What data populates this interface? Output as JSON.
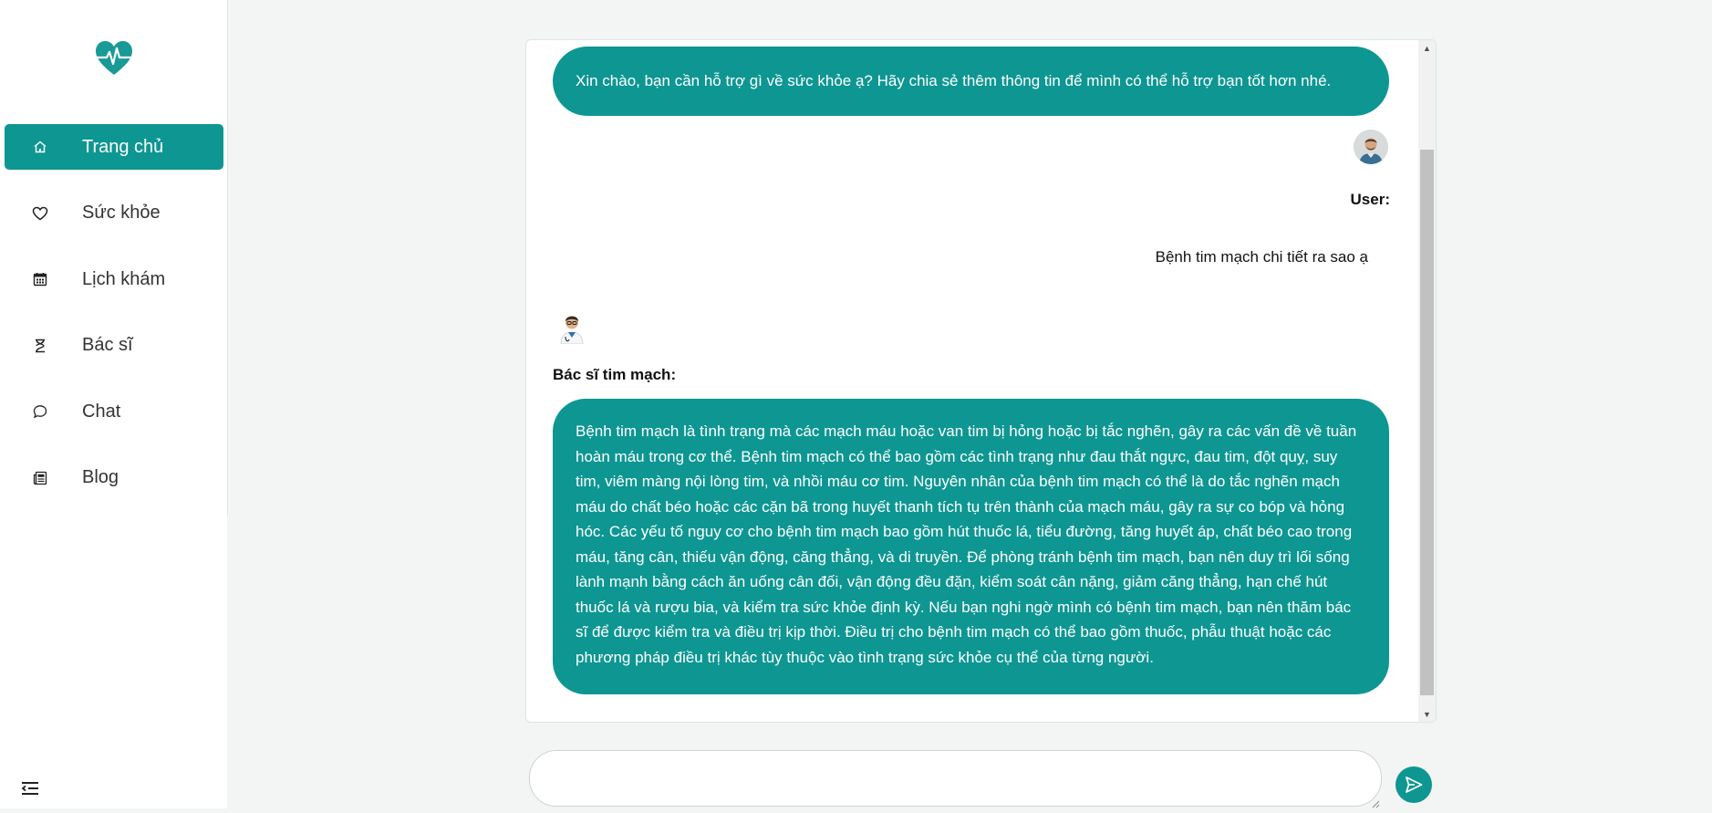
{
  "app": {
    "logo_icon": "heart-pulse-icon",
    "brand_color": "#0e9692"
  },
  "sidebar": {
    "items": [
      {
        "label": "Trang chủ",
        "icon": "home-icon",
        "active": true
      },
      {
        "label": "Sức khỏe",
        "icon": "heart-icon",
        "active": false
      },
      {
        "label": "Lịch khám",
        "icon": "calendar-icon",
        "active": false
      },
      {
        "label": "Bác sĩ",
        "icon": "doctor-icon",
        "active": false
      },
      {
        "label": "Chat",
        "icon": "chat-bubble-icon",
        "active": false
      },
      {
        "label": "Blog",
        "icon": "newspaper-icon",
        "active": false
      }
    ],
    "collapse_icon": "collapse-menu-icon"
  },
  "chat": {
    "messages": [
      {
        "role": "assistant",
        "text": "Xin chào, bạn cần hỗ trợ gì về sức khỏe ạ? Hãy chia sẻ thêm thông tin để mình có thể hỗ trợ bạn tốt hơn nhé."
      },
      {
        "role": "user",
        "sender": "User:",
        "text": "Bệnh tim mạch chi tiết ra sao ạ",
        "avatar": "user-avatar"
      },
      {
        "role": "assistant",
        "sender": "Bác sĩ tim mạch:",
        "text": "Bệnh tim mạch là tình trạng mà các mạch máu hoặc van tim bị hỏng hoặc bị tắc nghẽn, gây ra các vấn đề về tuần hoàn máu trong cơ thể. Bệnh tim mạch có thể bao gồm các tình trạng như đau thắt ngực, đau tim, đột quỵ, suy tim, viêm màng nội lòng tim, và nhồi máu cơ tim. Nguyên nhân của bệnh tim mạch có thể là do tắc nghẽn mạch máu do chất béo hoặc các cặn bã trong huyết thanh tích tụ trên thành của mạch máu, gây ra sự co bóp và hỏng hóc. Các yếu tố nguy cơ cho bệnh tim mạch bao gồm hút thuốc lá, tiểu đường, tăng huyết áp, chất béo cao trong máu, tăng cân, thiếu vận động, căng thẳng, và di truyền. Để phòng tránh bệnh tim mạch, bạn nên duy trì lối sống lành mạnh bằng cách ăn uống cân đối, vận động đều đặn, kiểm soát cân nặng, giảm căng thẳng, hạn chế hút thuốc lá và rượu bia, và kiểm tra sức khỏe định kỳ. Nếu bạn nghi ngờ mình có bệnh tim mạch, bạn nên thăm bác sĩ để được kiểm tra và điều trị kịp thời. Điều trị cho bệnh tim mạch có thể bao gồm thuốc, phẫu thuật hoặc các phương pháp điều trị khác tùy thuộc vào tình trạng sức khỏe cụ thể của từng người.",
        "avatar": "doctor-avatar"
      }
    ],
    "input": {
      "value": "",
      "placeholder": ""
    },
    "send_icon": "send-icon"
  }
}
